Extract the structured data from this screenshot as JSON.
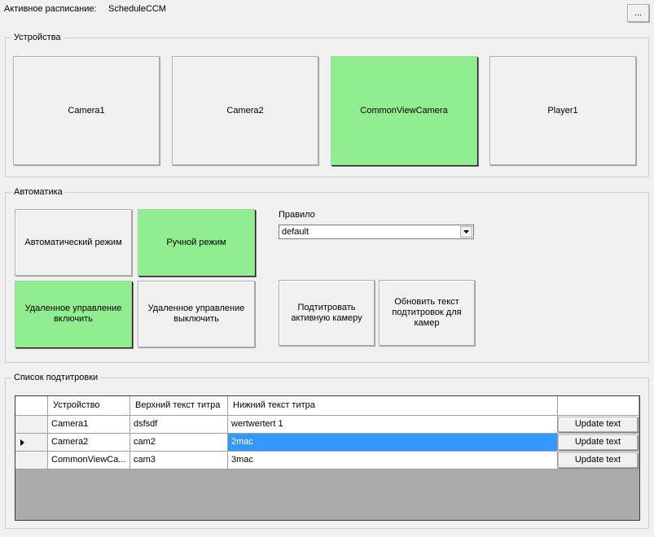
{
  "header": {
    "active_schedule_label": "Активное расписание:",
    "active_schedule_value": "ScheduleCCM",
    "more_button_label": "..."
  },
  "devices": {
    "title": "Устройства",
    "buttons": [
      {
        "label": "Camera1",
        "active": false
      },
      {
        "label": "Camera2",
        "active": false
      },
      {
        "label": "CommonViewCamera",
        "active": true
      },
      {
        "label": "Player1",
        "active": false
      }
    ]
  },
  "automation": {
    "title": "Автоматика",
    "auto_mode_label": "Автоматический режим",
    "manual_mode_label": "Ручной режим",
    "remote_on_label": "Удаленное управление включить",
    "remote_off_label": "Удаленное управление выключить",
    "rule_label": "Правило",
    "rule_value": "default",
    "subtitle_active_label": "Подтитровать активную камеру",
    "update_subtitles_label": "Обновить текст подтитровок для камер"
  },
  "subtitles": {
    "title": "Список подтитровки",
    "columns": [
      "Устройство",
      "Верхний текст титра",
      "Нижний текст титра",
      ""
    ],
    "rows": [
      {
        "device": "Camera1",
        "top": "dsfsdf",
        "bottom": "wertwertert 1",
        "action": "Update text",
        "current": false,
        "selected": false
      },
      {
        "device": "Camera2",
        "top": "cam2",
        "bottom": "2mac",
        "action": "Update text",
        "current": true,
        "selected": true
      },
      {
        "device": "CommonViewCa...",
        "top": "cam3",
        "bottom": "3mac",
        "action": "Update text",
        "current": false,
        "selected": false
      }
    ]
  },
  "colors": {
    "active_green": "#90ee90",
    "selection_blue": "#3399ff",
    "grid_background": "#ababab"
  }
}
